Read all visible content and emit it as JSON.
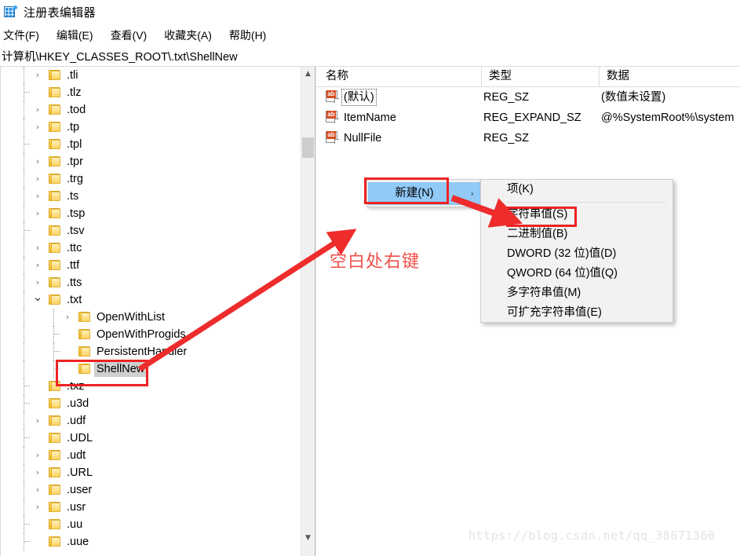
{
  "window": {
    "title": "注册表编辑器",
    "icon": "regedit-icon"
  },
  "menubar": {
    "items": [
      {
        "label": "文件(F)",
        "name": "menu-file"
      },
      {
        "label": "编辑(E)",
        "name": "menu-edit"
      },
      {
        "label": "查看(V)",
        "name": "menu-view"
      },
      {
        "label": "收藏夹(A)",
        "name": "menu-favorites"
      },
      {
        "label": "帮助(H)",
        "name": "menu-help"
      }
    ]
  },
  "address": {
    "path": "计算机\\HKEY_CLASSES_ROOT\\.txt\\ShellNew"
  },
  "tree": {
    "items": [
      {
        "label": ".tli",
        "depth": 0,
        "expander": "collapsed",
        "selected": false
      },
      {
        "label": ".tlz",
        "depth": 0,
        "expander": "none",
        "selected": false
      },
      {
        "label": ".tod",
        "depth": 0,
        "expander": "collapsed",
        "selected": false
      },
      {
        "label": ".tp",
        "depth": 0,
        "expander": "collapsed",
        "selected": false
      },
      {
        "label": ".tpl",
        "depth": 0,
        "expander": "none",
        "selected": false
      },
      {
        "label": ".tpr",
        "depth": 0,
        "expander": "collapsed",
        "selected": false
      },
      {
        "label": ".trg",
        "depth": 0,
        "expander": "collapsed",
        "selected": false
      },
      {
        "label": ".ts",
        "depth": 0,
        "expander": "collapsed",
        "selected": false
      },
      {
        "label": ".tsp",
        "depth": 0,
        "expander": "collapsed",
        "selected": false
      },
      {
        "label": ".tsv",
        "depth": 0,
        "expander": "none",
        "selected": false
      },
      {
        "label": ".ttc",
        "depth": 0,
        "expander": "collapsed",
        "selected": false
      },
      {
        "label": ".ttf",
        "depth": 0,
        "expander": "collapsed",
        "selected": false
      },
      {
        "label": ".tts",
        "depth": 0,
        "expander": "collapsed",
        "selected": false
      },
      {
        "label": ".txt",
        "depth": 0,
        "expander": "expanded",
        "selected": false
      },
      {
        "label": "OpenWithList",
        "depth": 1,
        "expander": "collapsed",
        "selected": false
      },
      {
        "label": "OpenWithProgids",
        "depth": 1,
        "expander": "none",
        "selected": false
      },
      {
        "label": "PersistentHandler",
        "depth": 1,
        "expander": "none",
        "selected": false
      },
      {
        "label": "ShellNew",
        "depth": 1,
        "expander": "none",
        "selected": true
      },
      {
        "label": ".txz",
        "depth": 0,
        "expander": "none",
        "selected": false
      },
      {
        "label": ".u3d",
        "depth": 0,
        "expander": "none",
        "selected": false
      },
      {
        "label": ".udf",
        "depth": 0,
        "expander": "collapsed",
        "selected": false
      },
      {
        "label": ".UDL",
        "depth": 0,
        "expander": "none",
        "selected": false
      },
      {
        "label": ".udt",
        "depth": 0,
        "expander": "collapsed",
        "selected": false
      },
      {
        "label": ".URL",
        "depth": 0,
        "expander": "collapsed",
        "selected": false
      },
      {
        "label": ".user",
        "depth": 0,
        "expander": "collapsed",
        "selected": false
      },
      {
        "label": ".usr",
        "depth": 0,
        "expander": "collapsed",
        "selected": false
      },
      {
        "label": ".uu",
        "depth": 0,
        "expander": "none",
        "selected": false
      },
      {
        "label": ".uue",
        "depth": 0,
        "expander": "none",
        "selected": false
      }
    ]
  },
  "value_list": {
    "columns": [
      "名称",
      "类型",
      "数据"
    ],
    "rows": [
      {
        "name": "(默认)",
        "type": "REG_SZ",
        "data": "(数值未设置)",
        "icon": "ab-string-icon",
        "focused": true
      },
      {
        "name": "ItemName",
        "type": "REG_EXPAND_SZ",
        "data": "@%SystemRoot%\\system",
        "icon": "ab-string-icon",
        "focused": false
      },
      {
        "name": "NullFile",
        "type": "REG_SZ",
        "data": "",
        "icon": "ab-string-icon",
        "focused": false
      }
    ]
  },
  "context_menu": {
    "parent_item": "新建(N)",
    "submenu_arrow": "›",
    "submenu_items": [
      "项(K)",
      "字符串值(S)",
      "二进制值(B)",
      "DWORD (32 位)值(D)",
      "QWORD (64 位)值(Q)",
      "多字符串值(M)",
      "可扩充字符串值(E)"
    ]
  },
  "annotations": {
    "note_text": "空白处右键",
    "highlight_color": "#ee2222",
    "note_color": "#f1504a",
    "boxes": [
      "shellnew-key",
      "new-menu-item",
      "string-value-item"
    ],
    "arrows": [
      "shellnew-to-blank-area",
      "new-to-string-value"
    ]
  },
  "watermark": {
    "text": "https://blog.csdn.net/qq_38671360"
  }
}
